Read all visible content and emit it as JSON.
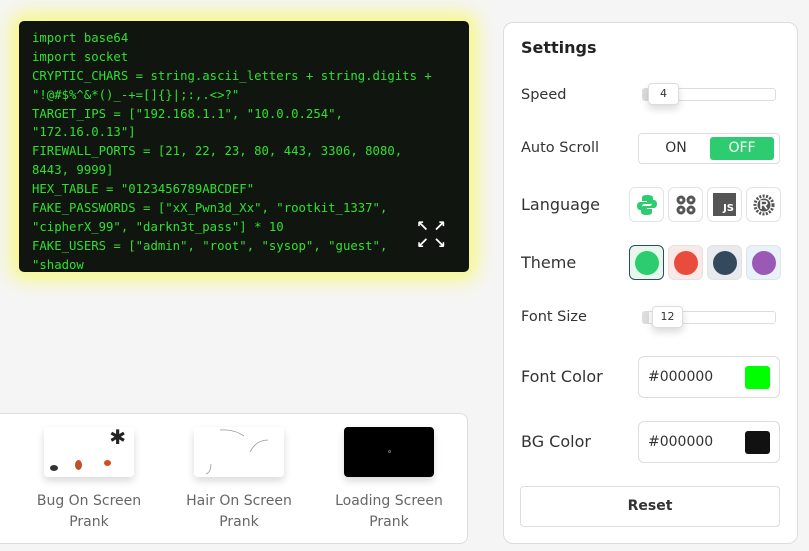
{
  "code": {
    "lines": [
      " ",
      "import base64",
      "import socket",
      "CRYPTIC_CHARS = string.ascii_letters + string.digits +",
      "\"!@#$%^&*()_-+=[]{}|;:,.<>?\"",
      "TARGET_IPS = [\"192.168.1.1\", \"10.0.0.254\",",
      "\"172.16.0.13\"]",
      "FIREWALL_PORTS = [21, 22, 23, 80, 443, 3306, 8080,",
      "8443, 9999]",
      "HEX_TABLE = \"0123456789ABCDEF\"",
      "FAKE_PASSWORDS = [\"xX_Pwn3d_Xx\", \"rootkit_1337\",",
      "\"cipherX_99\", \"darkn3t_pass\"] * 10",
      "FAKE_USERS = [\"admin\", \"root\", \"sysop\", \"guest\",",
      "\"shadow"
    ]
  },
  "settings": {
    "title": "Settings",
    "speed_label": "Speed",
    "speed": "4",
    "auto_scroll_label": "Auto Scroll",
    "on": "ON",
    "off": "OFF",
    "language_label": "Language",
    "js": "JS",
    "theme_label": "Theme",
    "themes": [
      "#2ecc71",
      "#e74c3c",
      "#34495e",
      "#9b59b6"
    ],
    "font_size_label": "Font Size",
    "font_size": "12",
    "font_color_label": "Font Color",
    "font_color_value": "#000000",
    "font_color_swatch": "#00ff00",
    "bg_color_label": "BG Color",
    "bg_color_value": "#000000",
    "bg_color_swatch": "#111111",
    "reset": "Reset"
  },
  "pranks": [
    {
      "line1": "Bug On Screen",
      "line2": "Prank"
    },
    {
      "line1": "Hair On Screen",
      "line2": "Prank"
    },
    {
      "line1": "Loading Screen",
      "line2": "Prank"
    }
  ]
}
